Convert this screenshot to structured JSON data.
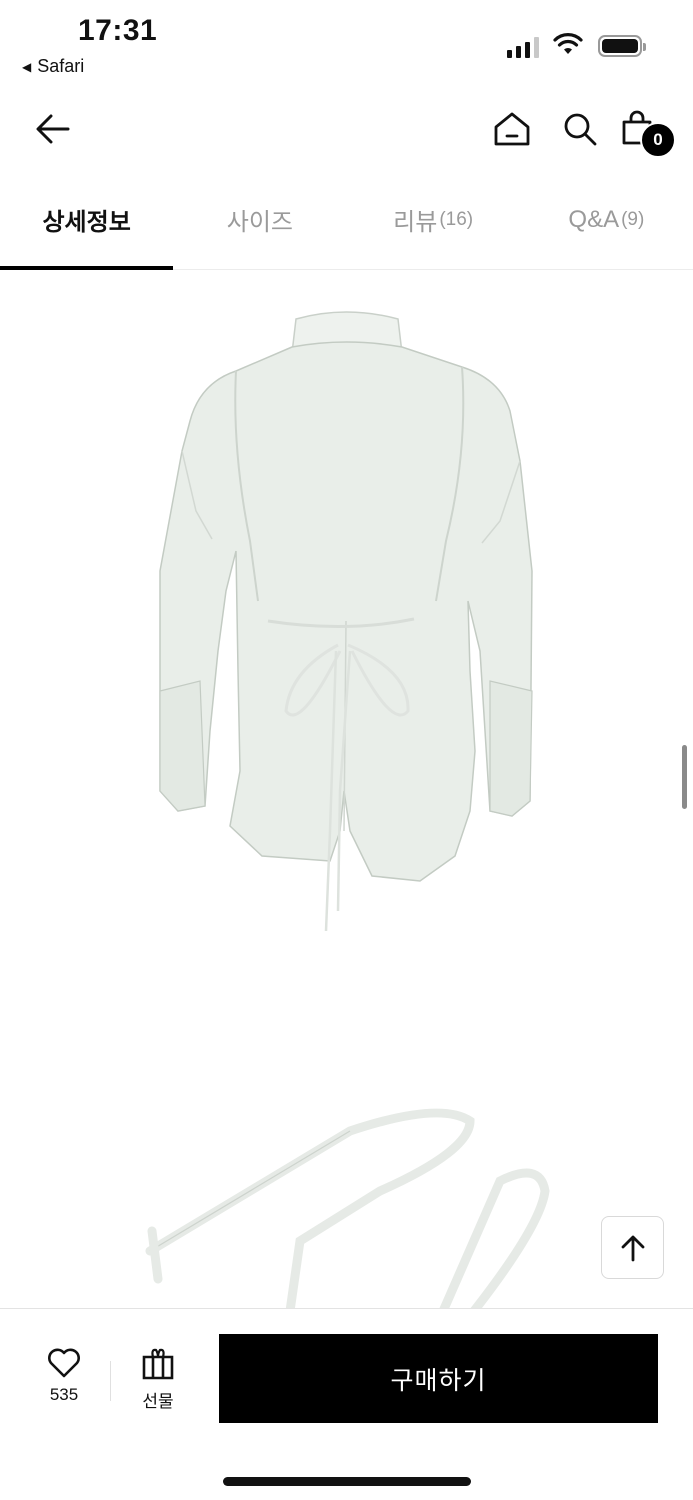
{
  "status_bar": {
    "time": "17:31",
    "back_app": "Safari",
    "back_icon": "triangle-left-icon"
  },
  "header": {
    "back_icon": "arrow-left-icon",
    "home_icon": "home-icon",
    "search_icon": "search-icon",
    "cart_icon": "shopping-bag-icon",
    "cart_count": "0"
  },
  "tabs": [
    {
      "label": "상세정보",
      "count": ""
    },
    {
      "label": "사이즈",
      "count": ""
    },
    {
      "label": "리뷰",
      "count": "(16)"
    },
    {
      "label": "Q&A",
      "count": "(9)"
    }
  ],
  "active_tab": 0,
  "content": {
    "images": [
      "shirt-back-view-image",
      "tie-strap-image"
    ]
  },
  "scroll_top_icon": "arrow-up-icon",
  "bottom_bar": {
    "like_icon": "heart-icon",
    "like_count": "535",
    "gift_icon": "gift-icon",
    "gift_label": "선물",
    "buy_label": "구매하기"
  },
  "colors": {
    "accent": "#000000",
    "inactive_tab": "#9a9a9a",
    "garment": "#e9eee9"
  }
}
